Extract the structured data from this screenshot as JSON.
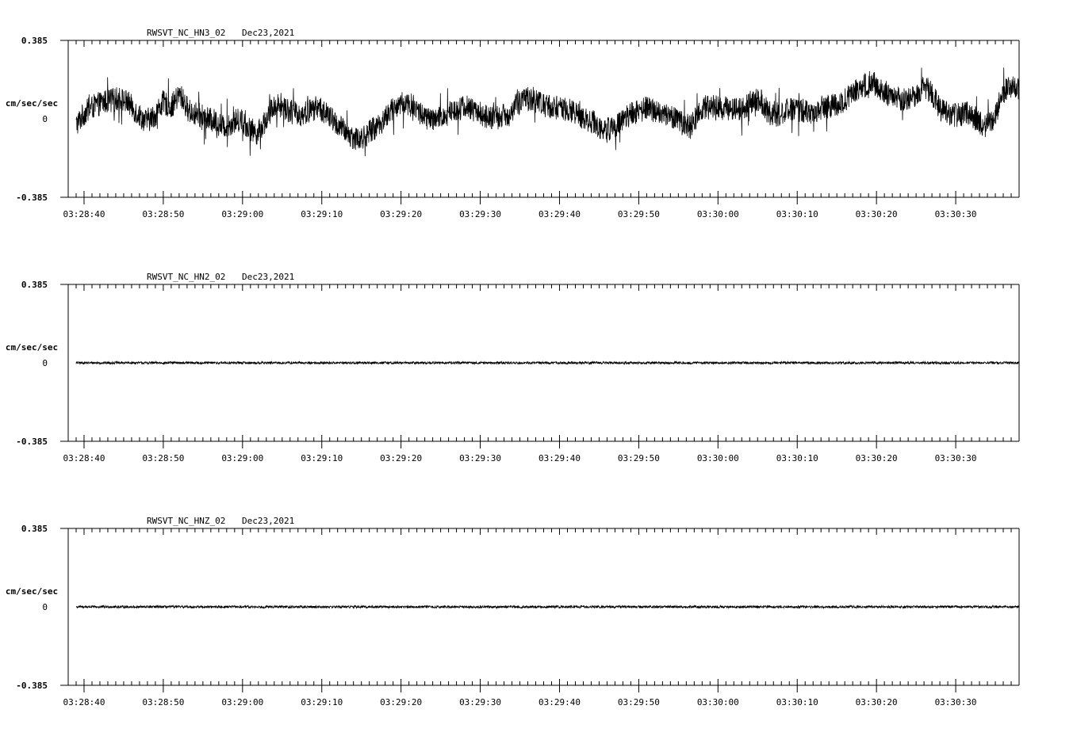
{
  "chart_data": [
    {
      "type": "line",
      "title": "RWSVT_NC_HN3_02",
      "date": "Dec23,2021",
      "ylabel": "cm/sec/sec",
      "ylim": [
        -0.385,
        0.385
      ],
      "y_ticks": [
        "0.385",
        "0",
        "-0.385"
      ],
      "x_ticks": [
        "03:28:40",
        "03:28:50",
        "03:29:00",
        "03:29:10",
        "03:29:20",
        "03:29:30",
        "03:29:40",
        "03:29:50",
        "03:30:00",
        "03:30:10",
        "03:30:20",
        "03:30:30"
      ],
      "xlim": [
        "03:28:38",
        "03:30:38"
      ],
      "trace_start": "03:28:39",
      "series": [
        {
          "values": [
            -0.03,
            0.03,
            0.06,
            0.08,
            0.09,
            0.1,
            0.08,
            0.03,
            -0.01,
            0.01,
            0.08,
            0.06,
            0.12,
            0.04,
            0.02,
            0.0,
            -0.01,
            -0.04,
            -0.02,
            0.0,
            -0.05,
            -0.07,
            0.0,
            0.07,
            0.06,
            0.03,
            0.02,
            0.04,
            0.06,
            0.02,
            -0.02,
            -0.06,
            -0.09,
            -0.1,
            -0.06,
            -0.03,
            0.02,
            0.06,
            0.08,
            0.06,
            0.02,
            -0.01,
            0.0,
            0.03,
            0.05,
            0.06,
            0.04,
            0.02,
            0.0,
            0.01,
            0.02,
            0.07,
            0.1,
            0.1,
            0.07,
            0.06,
            0.05,
            0.04,
            0.02,
            0.0,
            -0.02,
            -0.06,
            -0.04,
            -0.01,
            0.02,
            0.04,
            0.05,
            0.04,
            0.02,
            0.01,
            -0.02,
            -0.04,
            0.03,
            0.07,
            0.06,
            0.05,
            0.05,
            0.05,
            0.08,
            0.1,
            0.03,
            0.02,
            0.04,
            0.05,
            0.04,
            0.03,
            0.05,
            0.06,
            0.07,
            0.1,
            0.14,
            0.16,
            0.18,
            0.15,
            0.12,
            0.1,
            0.09,
            0.12,
            0.16,
            0.12,
            0.04,
            0.02,
            0.02,
            0.03,
            0.0,
            -0.04,
            -0.02,
            0.12,
            0.16,
            0.14
          ]
        }
      ]
    },
    {
      "type": "line",
      "title": "RWSVT_NC_HN2_02",
      "date": "Dec23,2021",
      "ylabel": "cm/sec/sec",
      "ylim": [
        -0.385,
        0.385
      ],
      "y_ticks": [
        "0.385",
        "0",
        "-0.385"
      ],
      "x_ticks": [
        "03:28:40",
        "03:28:50",
        "03:29:00",
        "03:29:10",
        "03:29:20",
        "03:29:30",
        "03:29:40",
        "03:29:50",
        "03:30:00",
        "03:30:10",
        "03:30:20",
        "03:30:30"
      ],
      "xlim": [
        "03:28:38",
        "03:30:38"
      ],
      "trace_start": "03:28:39",
      "series": [
        {
          "values": [
            0.0,
            0.0,
            0.0,
            0.0,
            0.0,
            0.0,
            0.0,
            0.0,
            0.0,
            0.0,
            0.0,
            0.0,
            0.0,
            0.0,
            0.0,
            0.0,
            0.0,
            0.0,
            0.0,
            0.0,
            0.0,
            0.0,
            0.0,
            0.0,
            0.0,
            0.0,
            0.0,
            0.0,
            0.0,
            0.0,
            0.0,
            0.0,
            0.0,
            0.0,
            0.0,
            0.0,
            0.0,
            0.0,
            0.0,
            0.0,
            0.0,
            0.0,
            0.0,
            0.0,
            0.0,
            0.0,
            0.0,
            0.0,
            0.0,
            0.0,
            0.0,
            0.0,
            0.0,
            0.0,
            0.0,
            0.0,
            0.0,
            0.0,
            0.0,
            0.0,
            0.0,
            0.0,
            0.0,
            0.0,
            0.0,
            0.0,
            0.0,
            0.0,
            0.0,
            0.0,
            0.0,
            0.0,
            0.0,
            0.0,
            0.0,
            0.0,
            0.0,
            0.0,
            0.0,
            0.0,
            0.0,
            0.0,
            0.0,
            0.0,
            0.0,
            0.0,
            0.0,
            0.0,
            0.0,
            0.0,
            0.0,
            0.0,
            0.0,
            0.0,
            0.0,
            0.0,
            0.0,
            0.0,
            0.0,
            0.0,
            0.0,
            0.0,
            0.0,
            0.0,
            0.0,
            0.0,
            0.0,
            0.0,
            0.0,
            0.0
          ]
        }
      ]
    },
    {
      "type": "line",
      "title": "RWSVT_NC_HNZ_02",
      "date": "Dec23,2021",
      "ylabel": "cm/sec/sec",
      "ylim": [
        -0.385,
        0.385
      ],
      "y_ticks": [
        "0.385",
        "0",
        "-0.385"
      ],
      "x_ticks": [
        "03:28:40",
        "03:28:50",
        "03:29:00",
        "03:29:10",
        "03:29:20",
        "03:29:30",
        "03:29:40",
        "03:29:50",
        "03:30:00",
        "03:30:10",
        "03:30:20",
        "03:30:30"
      ],
      "xlim": [
        "03:28:38",
        "03:30:38"
      ],
      "trace_start": "03:28:39",
      "series": [
        {
          "values": [
            0.0,
            0.0,
            0.0,
            0.0,
            0.0,
            0.0,
            0.0,
            0.0,
            0.0,
            0.0,
            0.0,
            0.0,
            0.0,
            0.0,
            0.0,
            0.0,
            0.0,
            0.0,
            0.0,
            0.0,
            0.0,
            0.0,
            0.0,
            0.0,
            0.0,
            0.0,
            0.0,
            0.0,
            0.0,
            0.0,
            0.0,
            0.0,
            0.0,
            0.0,
            0.0,
            0.0,
            0.0,
            0.0,
            0.0,
            0.0,
            0.0,
            0.0,
            0.0,
            0.0,
            0.0,
            0.0,
            0.0,
            0.0,
            0.0,
            0.0,
            0.0,
            0.0,
            0.0,
            0.0,
            0.0,
            0.0,
            0.0,
            0.0,
            0.0,
            0.0,
            0.0,
            0.0,
            0.0,
            0.0,
            0.0,
            0.0,
            0.0,
            0.0,
            0.0,
            0.0,
            0.0,
            0.0,
            0.0,
            0.0,
            0.0,
            0.0,
            0.0,
            0.0,
            0.0,
            0.0,
            0.0,
            0.0,
            0.0,
            0.0,
            0.0,
            0.0,
            0.0,
            0.0,
            0.0,
            0.0,
            0.0,
            0.0,
            0.0,
            0.0,
            0.0,
            0.0,
            0.0,
            0.0,
            0.0,
            0.0,
            0.0,
            0.0,
            0.0,
            0.0,
            0.0,
            0.0,
            0.0,
            0.0,
            0.0,
            0.0
          ]
        }
      ]
    }
  ]
}
